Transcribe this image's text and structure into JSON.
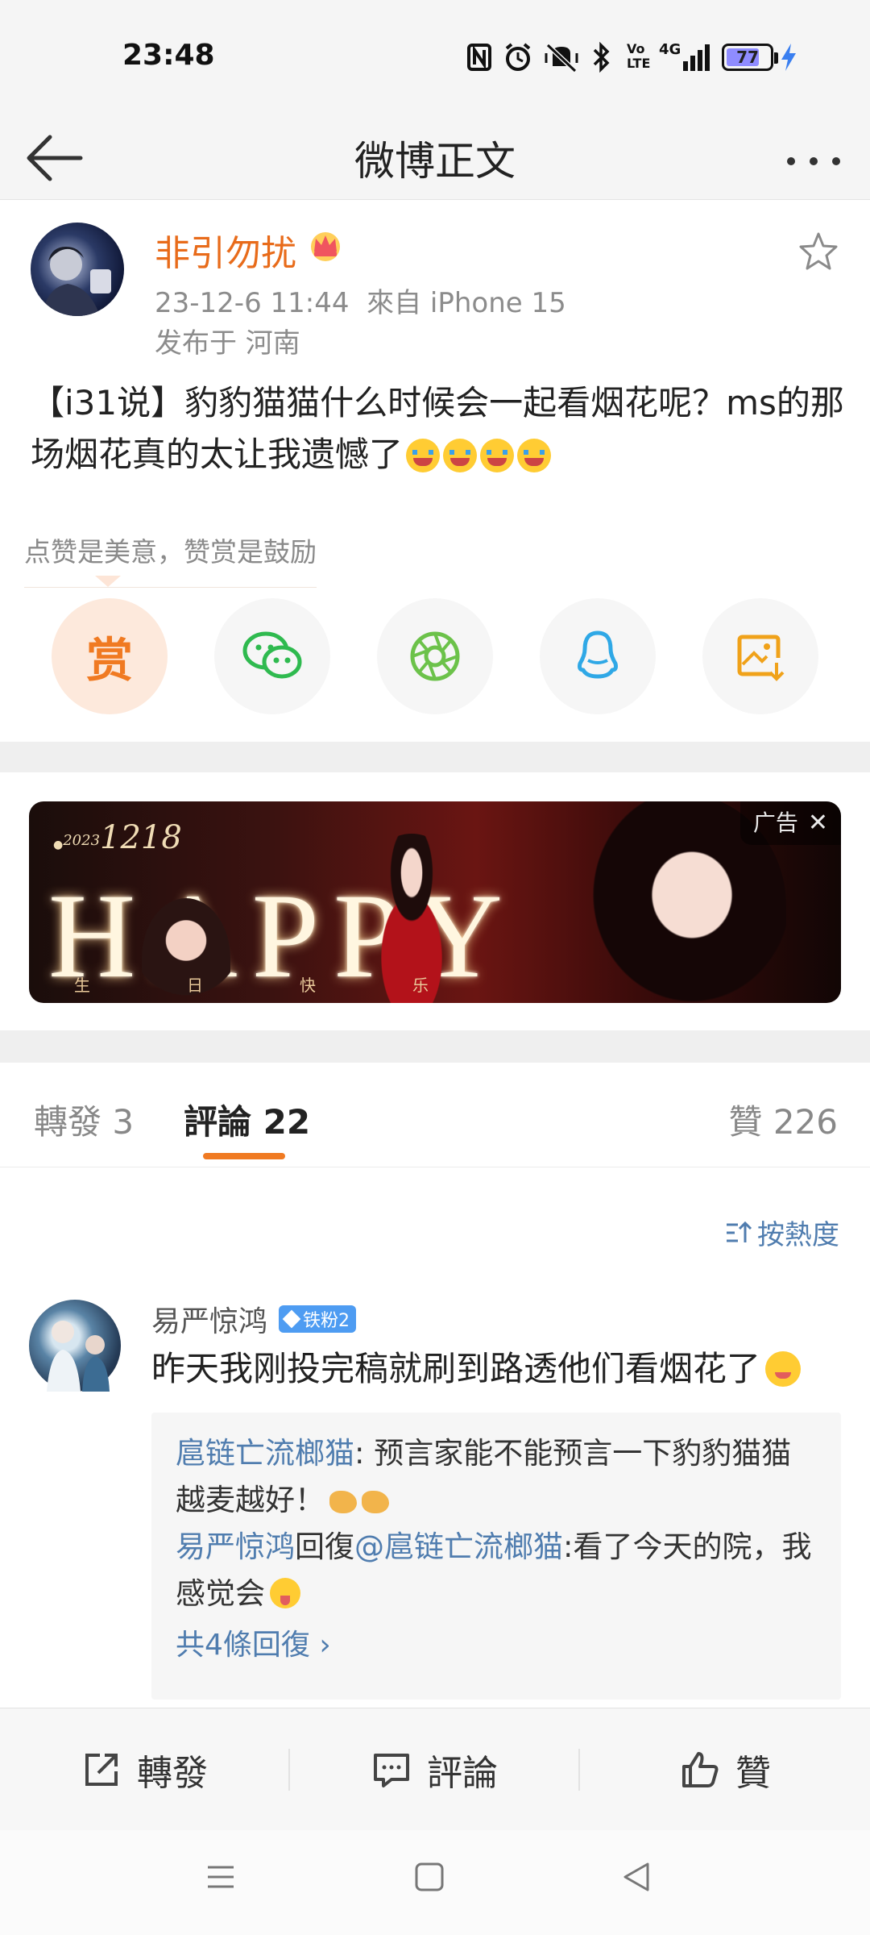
{
  "status_bar": {
    "time": "23:48",
    "battery": "77",
    "battery_level_percent": 77,
    "network": "4G",
    "icons": [
      "nfc-icon",
      "alarm-icon",
      "mute-vibrate-icon",
      "bluetooth-icon",
      "volte-icon",
      "signal-icon",
      "battery-icon",
      "charging-icon"
    ]
  },
  "nav": {
    "title": "微博正文",
    "back_icon": "back-arrow-icon",
    "more_icon": "more-dots-icon"
  },
  "post": {
    "username": "非引勿扰",
    "meta": "23-12-6 11:44  來自 iPhone 15",
    "location": "发布于 河南",
    "text": "【i31说】豹豹猫猫什么时候会一起看烟花呢？ms的那场烟花真的太让我遗憾了",
    "reward_hint": "点赞是美意，赞赏是鼓励",
    "reward_button": "赏",
    "share_buttons": [
      "wechat-icon",
      "moments-icon",
      "qq-icon",
      "save-image-icon"
    ]
  },
  "ad": {
    "date_year": "2023",
    "date": "1218",
    "headline": "HAPPY",
    "subtitle": "生日快乐",
    "tag": "广告",
    "close": "✕"
  },
  "tabs": {
    "repost": "轉發 3",
    "comments": "評論 22",
    "likes": "贊 226"
  },
  "comments": {
    "sort_label": "按熱度",
    "items": [
      {
        "user": "易严惊鸿",
        "badge": "铁粉2",
        "text": "昨天我刚投完稿就刷到路透他们看烟花了",
        "replies": [
          {
            "name": "扈链亡流榔猫",
            "text": ": 预言家能不能预言一下豹豹猫猫越麦越好！"
          },
          {
            "name": "易严惊鸿",
            "mid": "回復",
            "mention": "@扈链亡流榔猫",
            "text": ":看了今天的院，我感觉会"
          }
        ],
        "more_replies": "共4條回復 ›"
      }
    ]
  },
  "action_bar": {
    "repost": "轉發",
    "comment": "評論",
    "like": "贊"
  },
  "colors": {
    "accent": "#f07a22",
    "username": "#e86b1a",
    "link": "#507daf"
  }
}
